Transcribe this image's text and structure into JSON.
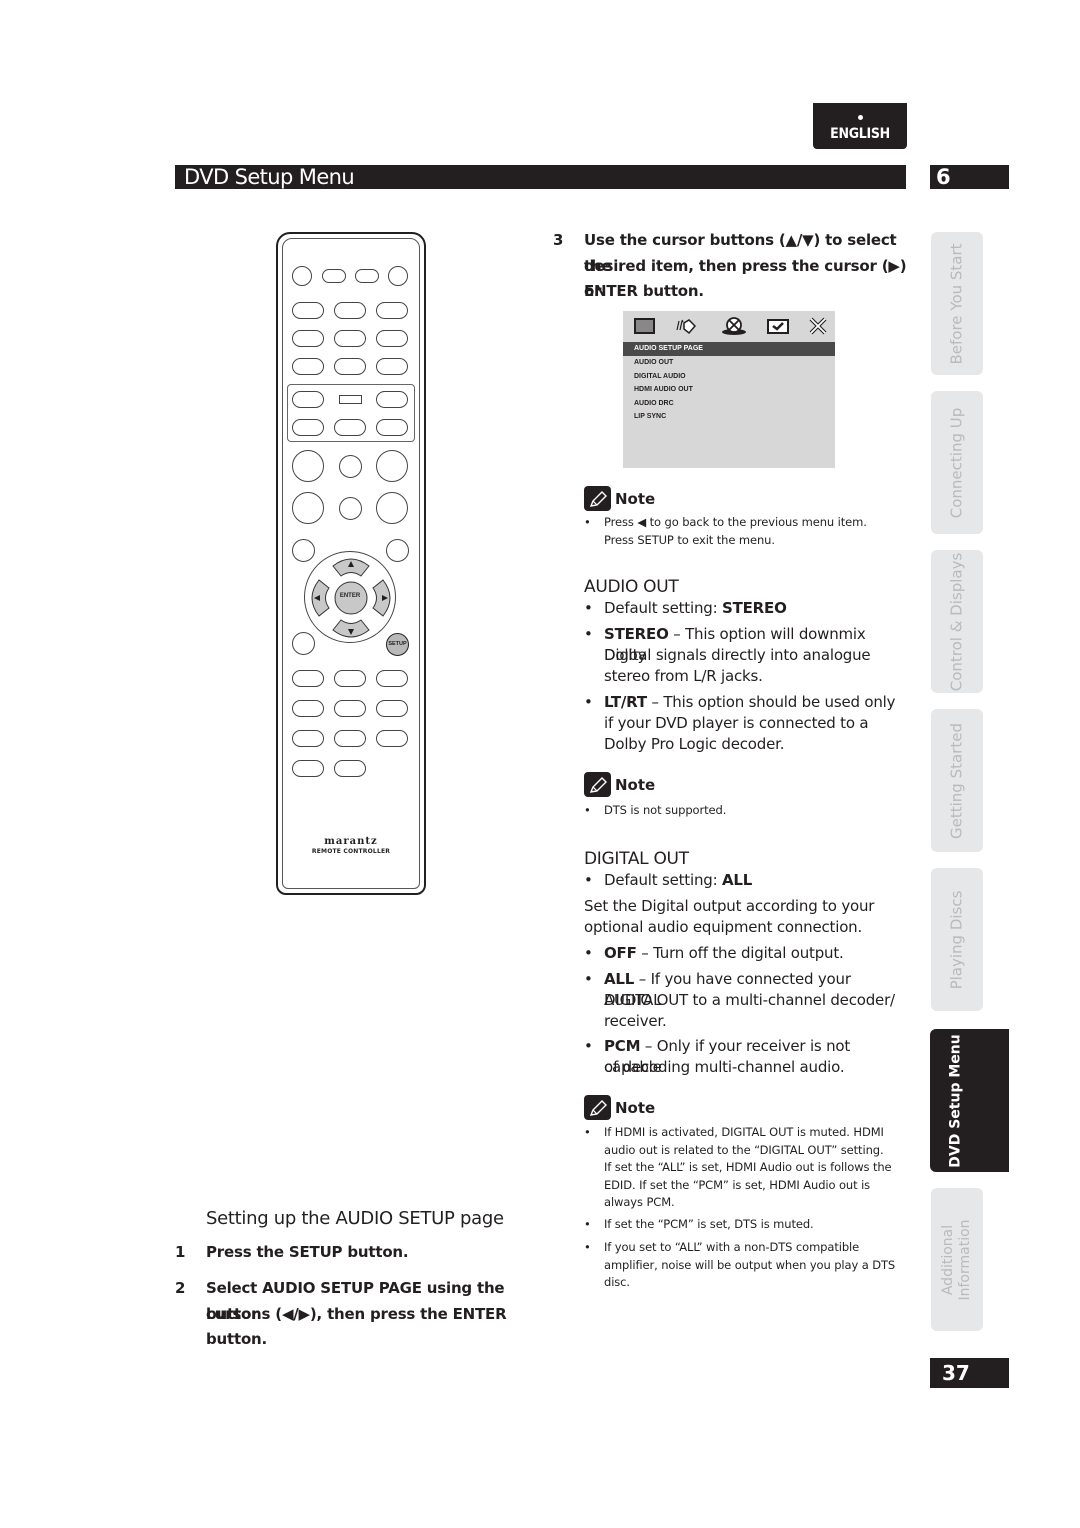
{
  "header": {
    "language_tab": "ENGLISH",
    "section_title": "DVD Setup Menu",
    "chapter_number": "6"
  },
  "remote": {
    "brand": "marantz",
    "subtitle": "REMOTE CONTROLLER",
    "enter_label": "ENTER",
    "setup_label": "SETUP"
  },
  "left_column": {
    "heading": "Setting up the AUDIO SETUP page",
    "steps": [
      {
        "num": "1",
        "text": "Press the SETUP button."
      },
      {
        "num": "2",
        "line1": "Select AUDIO SETUP PAGE using the cursor",
        "line2": "buttons (◀/▶), then press the ENTER",
        "line3": "button."
      }
    ]
  },
  "right_column": {
    "step3": {
      "num": "3",
      "line1": "Use the cursor buttons (▲/▼) to select the",
      "line2": "desired item, then press the cursor (▶) or",
      "line3": "ENTER button."
    },
    "osd_menu": {
      "icons": [
        "tv-screen-icon",
        "speaker-icon",
        "disc-icon",
        "checkbox-icon",
        "close-icon"
      ],
      "title": "AUDIO SETUP PAGE",
      "items": [
        "AUDIO OUT",
        "DIGITAL AUDIO",
        "HDMI AUDIO OUT",
        "AUDIO DRC",
        "LIP SYNC"
      ]
    },
    "note1": {
      "label": "Note",
      "bullets": [
        {
          "line1": "Press ◀ to go back to the previous menu item.",
          "line2": "Press SETUP to exit the menu."
        }
      ]
    },
    "audio_out": {
      "heading": "AUDIO OUT",
      "default_prefix": "Default setting: ",
      "default_value": "STEREO",
      "options": [
        {
          "key": "STEREO",
          "dash": " – ",
          "line1": "This option will downmix Dolby",
          "line2": "Digital signals directly into analogue",
          "line3": "stereo from L/R jacks."
        },
        {
          "key": "LT/RT",
          "dash": " – ",
          "line1": "This option should be used only",
          "line2": "if your DVD player is connected to a",
          "line3": "Dolby Pro Logic decoder."
        }
      ]
    },
    "note2": {
      "label": "Note",
      "bullets": [
        "DTS is not supported."
      ]
    },
    "digital_out": {
      "heading": "DIGITAL OUT",
      "default_prefix": "Default setting: ",
      "default_value": "ALL",
      "intro_line1": "Set the Digital output according to your",
      "intro_line2": "optional audio equipment connection.",
      "options": [
        {
          "key": "OFF",
          "dash": " – ",
          "line1": "Turn off the digital output."
        },
        {
          "key": "ALL",
          "dash": " – ",
          "line1": "If you have connected your DIGITAL",
          "line2": "AUDIO OUT to a multi-channel decoder/",
          "line3": "receiver."
        },
        {
          "key": "PCM",
          "dash": " – ",
          "line1": "Only if your receiver is not capable",
          "line2": "of decoding multi-channel audio."
        }
      ]
    },
    "note3": {
      "label": "Note",
      "bullets": [
        {
          "lines": [
            "If HDMI is activated, DIGITAL OUT is muted. HDMI",
            "audio out is related to the “DIGITAL OUT” setting.",
            "If set the “ALL” is set, HDMI Audio out is follows the",
            "EDID. If set the “PCM” is set, HDMI Audio out is",
            "always PCM."
          ]
        },
        {
          "lines": [
            "If set the “PCM” is set, DTS is muted."
          ]
        },
        {
          "lines": [
            "If you set to “ALL” with a non-DTS compatible",
            "amplifier, noise will be output when you play a DTS",
            "disc."
          ]
        }
      ]
    }
  },
  "side_tabs": [
    {
      "label": "Before You Start",
      "active": false
    },
    {
      "label": "Connecting Up",
      "active": false
    },
    {
      "label": "Control & Displays",
      "active": false
    },
    {
      "label": "Getting Started",
      "active": false
    },
    {
      "label": "Playing Discs",
      "active": false
    },
    {
      "label": "DVD Setup Menu",
      "active": true
    },
    {
      "label1": "Additional",
      "label2": "Information",
      "active": false
    }
  ],
  "footer": {
    "page_number": "37"
  }
}
